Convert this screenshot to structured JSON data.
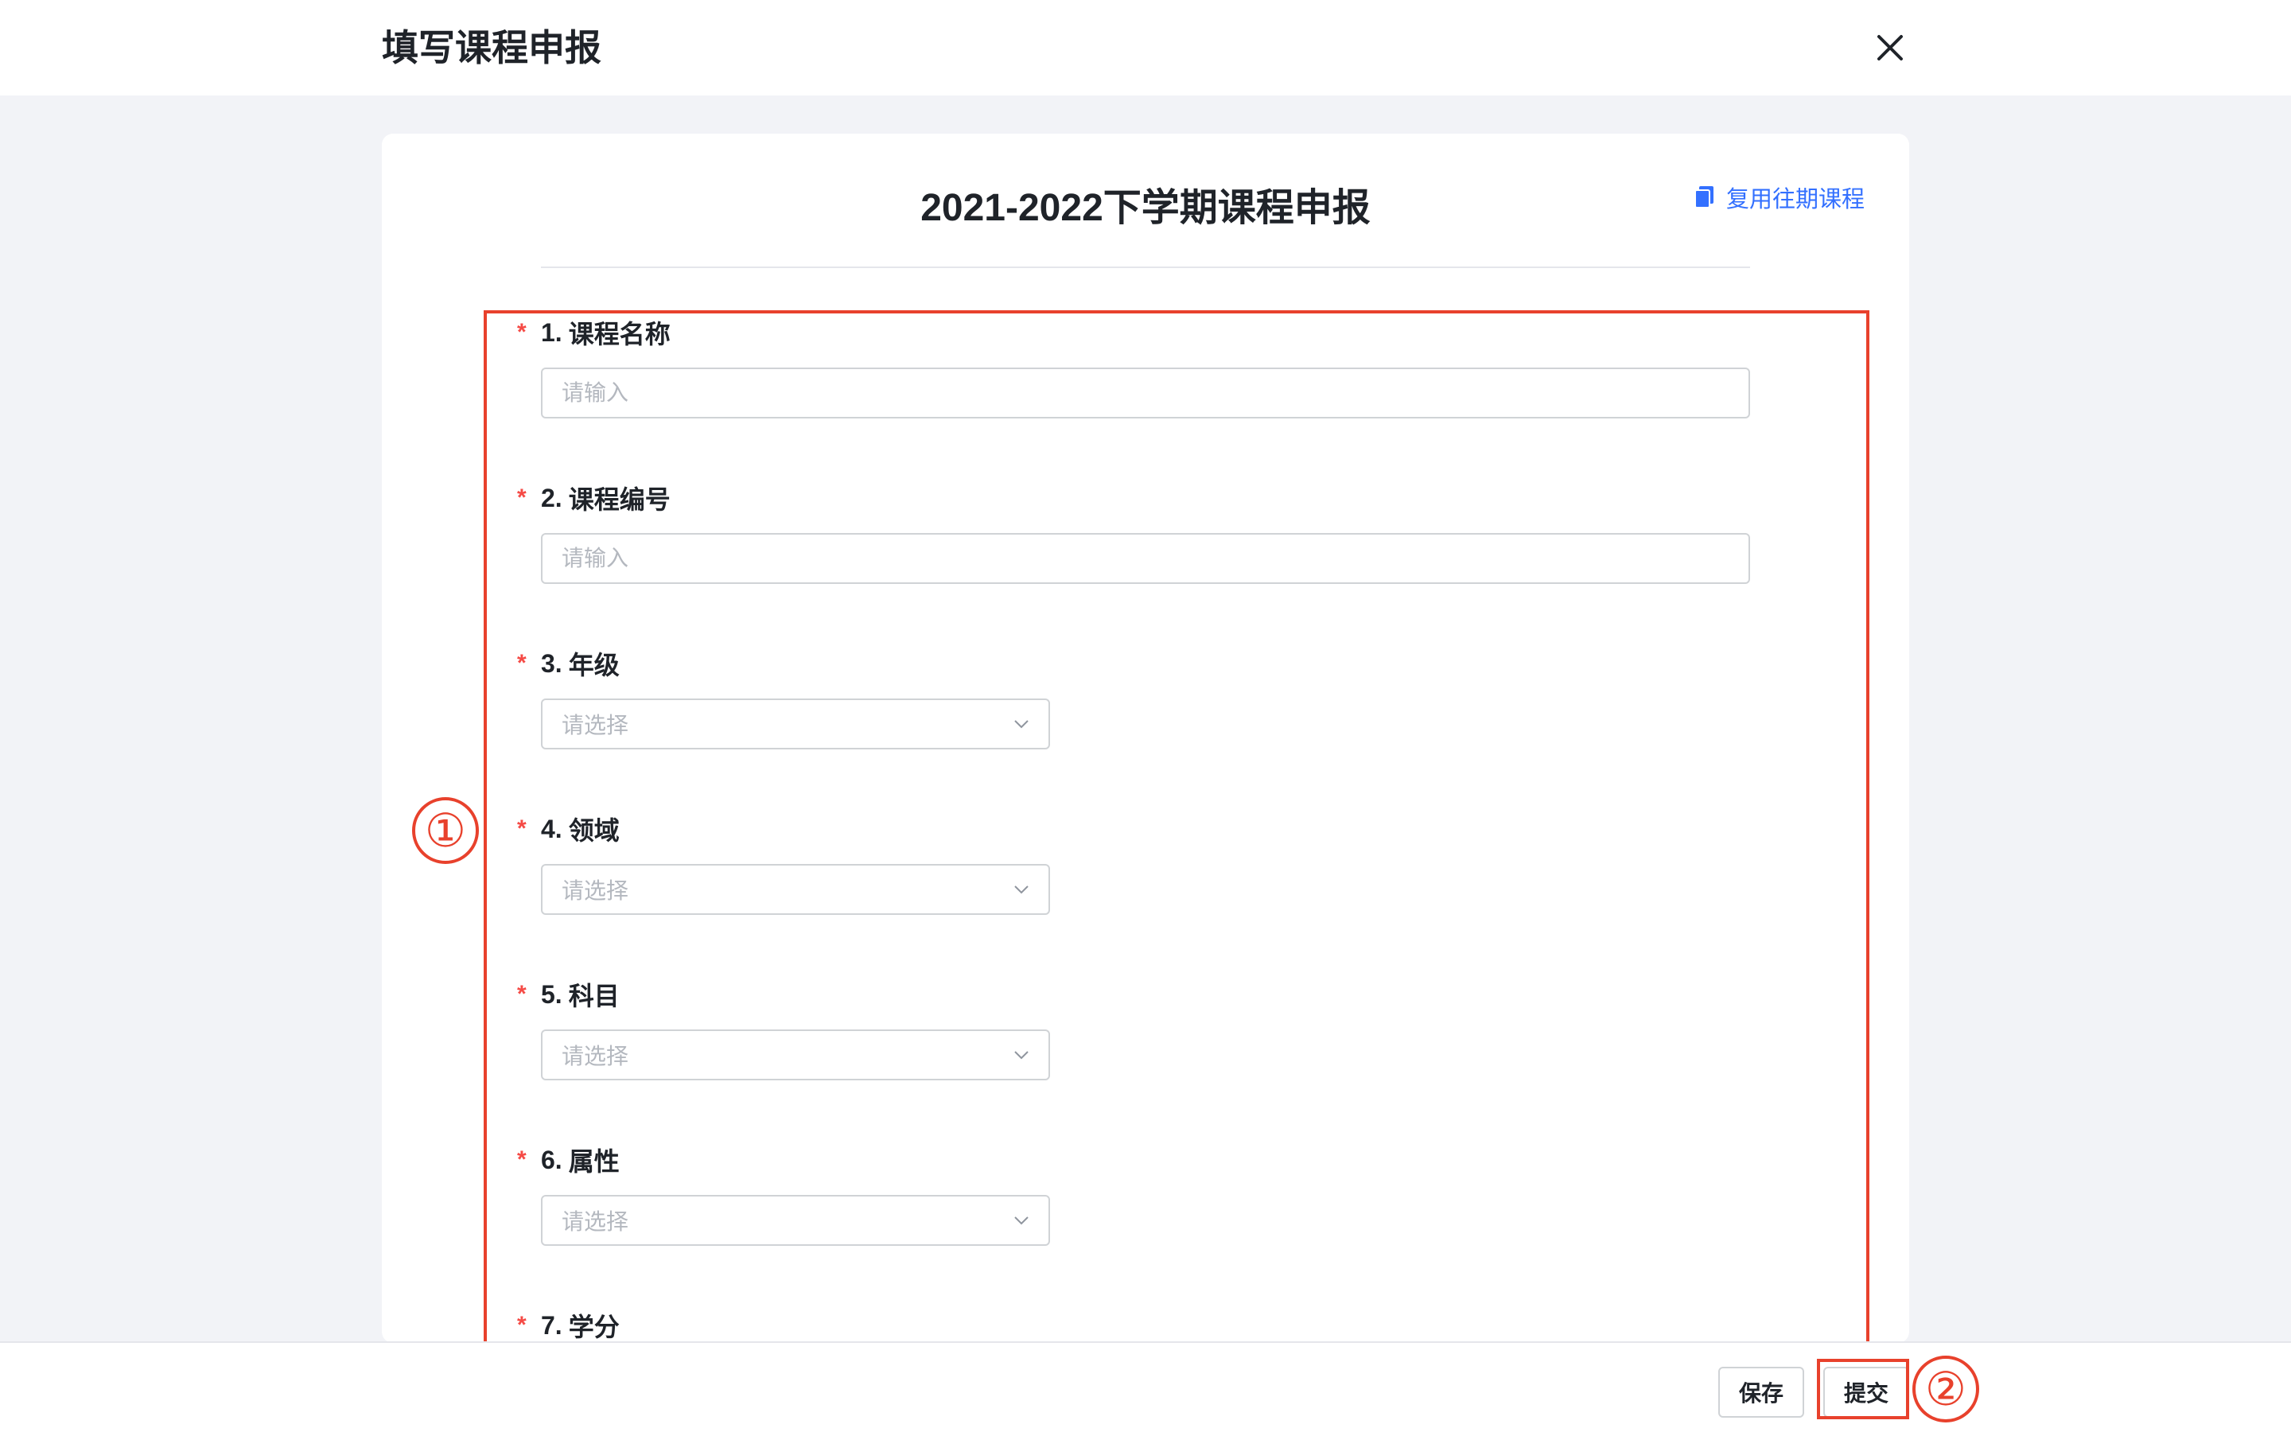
{
  "header": {
    "title": "填写课程申报"
  },
  "card": {
    "title": "2021-2022下学期课程申报",
    "reuse_label": "复用往期课程"
  },
  "form": {
    "required_mark": "*",
    "fields": [
      {
        "num": "1.",
        "label": "课程名称",
        "type": "input",
        "placeholder": "请输入"
      },
      {
        "num": "2.",
        "label": "课程编号",
        "type": "input",
        "placeholder": "请输入"
      },
      {
        "num": "3.",
        "label": "年级",
        "type": "select",
        "placeholder": "请选择"
      },
      {
        "num": "4.",
        "label": "领域",
        "type": "select",
        "placeholder": "请选择"
      },
      {
        "num": "5.",
        "label": "科目",
        "type": "select",
        "placeholder": "请选择"
      },
      {
        "num": "6.",
        "label": "属性",
        "type": "select",
        "placeholder": "请选择"
      },
      {
        "num": "7.",
        "label": "学分"
      }
    ]
  },
  "annotations": {
    "marker_1": "①",
    "marker_2": "②",
    "color": "#e8412c"
  },
  "footer": {
    "save_label": "保存",
    "submit_label": "提交"
  },
  "colors": {
    "accent": "#3370ff",
    "required": "#f54a45",
    "background": "#f2f3f7"
  }
}
